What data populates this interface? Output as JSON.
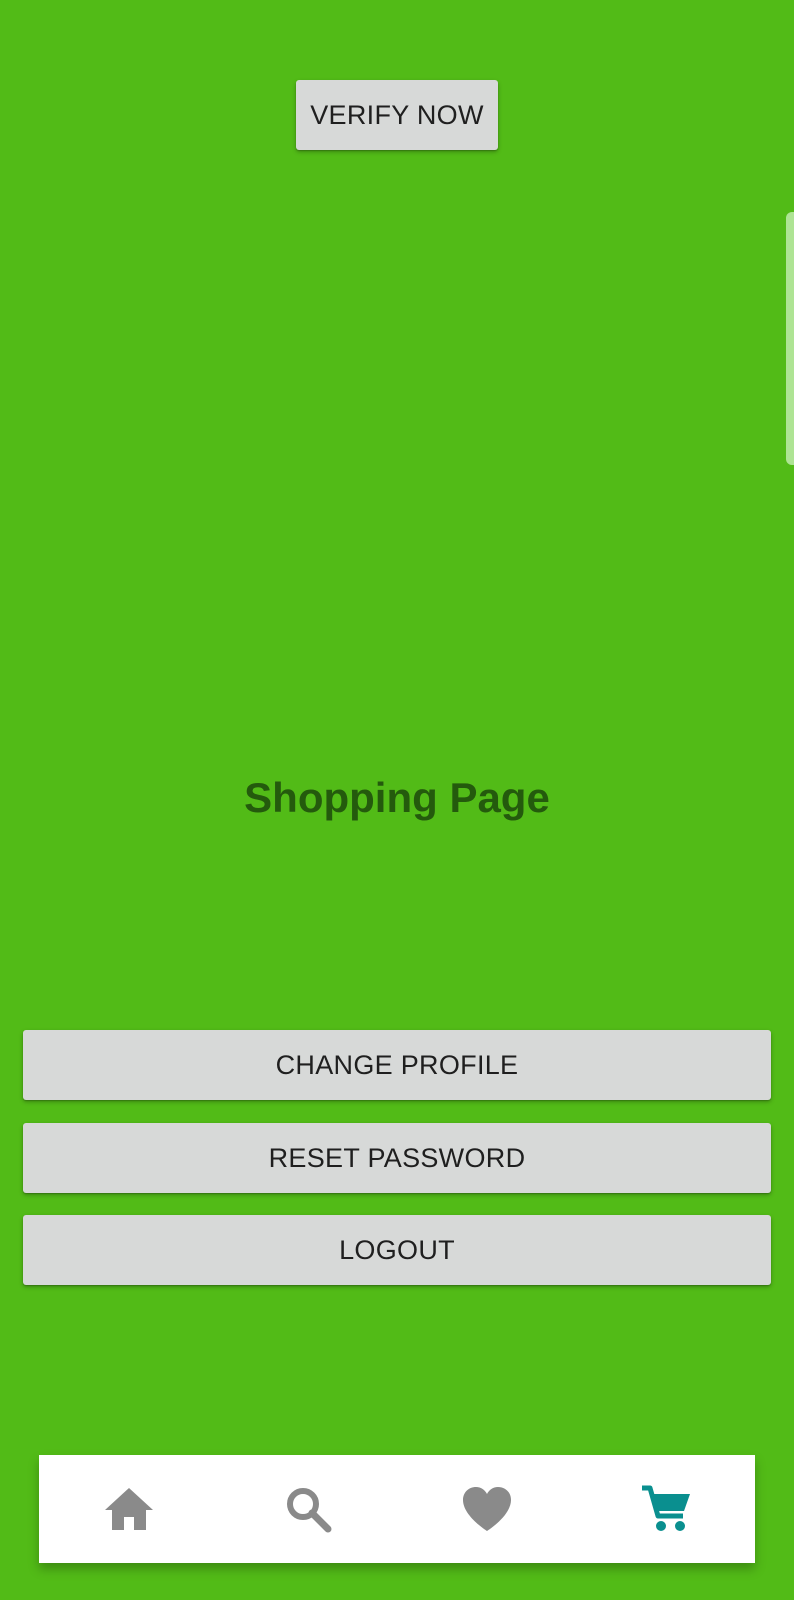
{
  "header": {
    "verify_label": "VERIFY NOW"
  },
  "main": {
    "title": "Shopping Page"
  },
  "actions": {
    "change_profile_label": "CHANGE PROFILE",
    "reset_password_label": "RESET PASSWORD",
    "logout_label": "LOGOUT"
  },
  "bottom_nav": {
    "items": [
      {
        "icon": "home-icon",
        "active": false
      },
      {
        "icon": "search-icon",
        "active": false
      },
      {
        "icon": "heart-icon",
        "active": false
      },
      {
        "icon": "cart-icon",
        "active": true
      }
    ],
    "inactive_color": "#8a8a8a",
    "active_color": "#0a8f8f"
  },
  "colors": {
    "background": "#52bb17",
    "title": "#245a0d",
    "button_bg": "#d7d9d8"
  }
}
